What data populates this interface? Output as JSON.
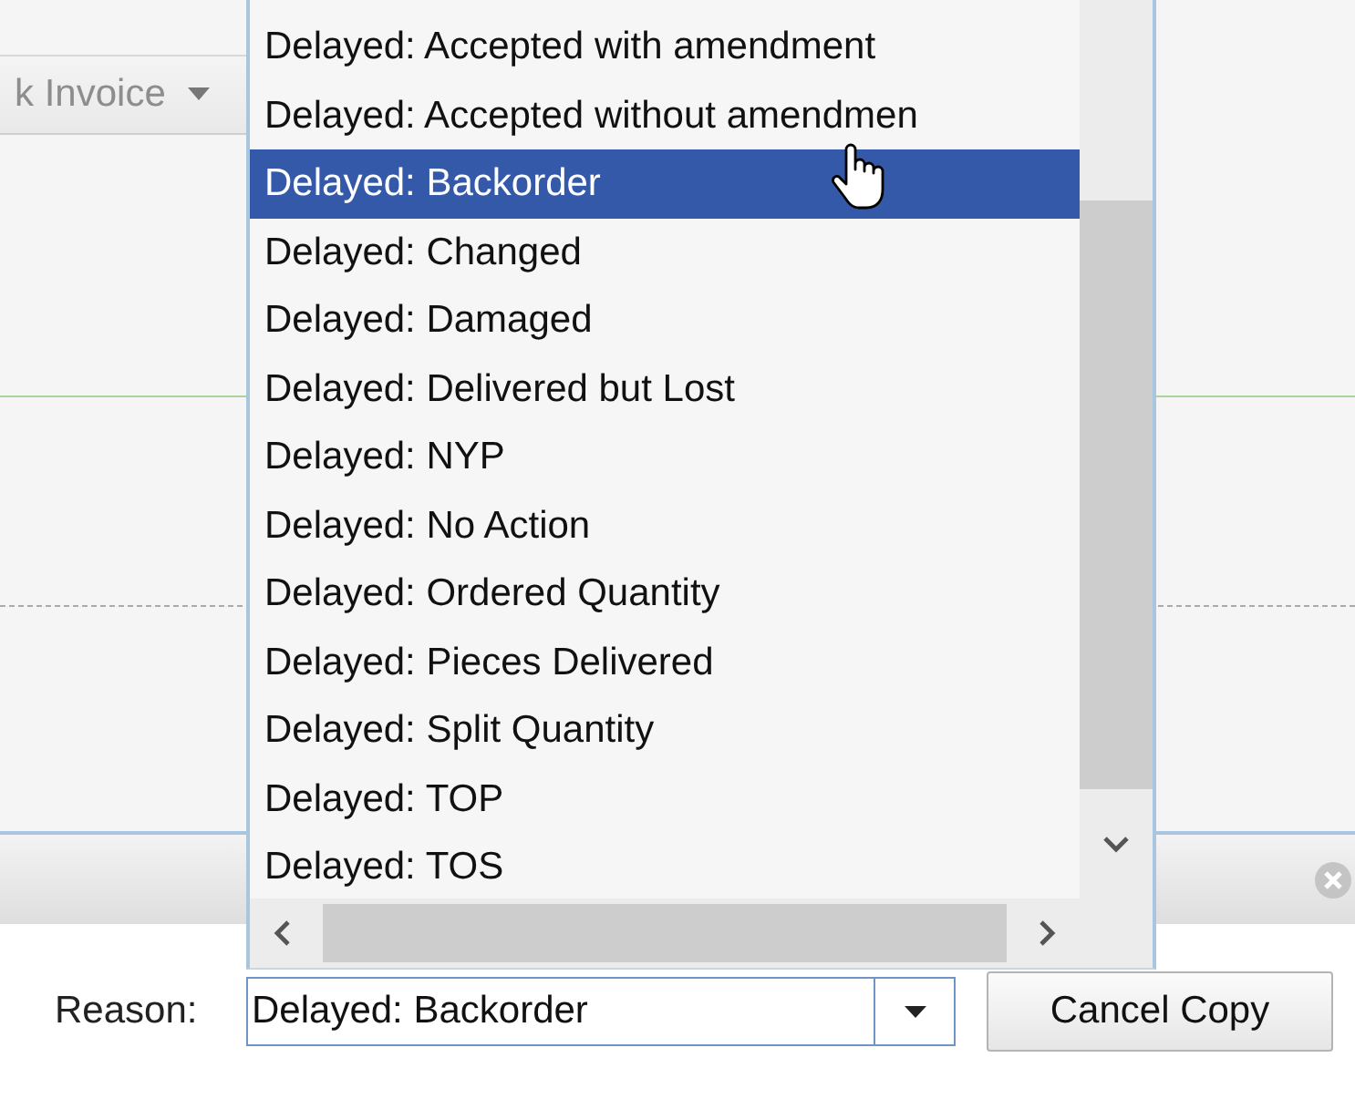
{
  "background": {
    "toolbar_dropdown": {
      "value": "k Invoice"
    }
  },
  "dropdown_list": {
    "items": [
      {
        "label": "Delayed: Accepted with amendment",
        "selected": false
      },
      {
        "label": "Delayed: Accepted without amendmen",
        "selected": false
      },
      {
        "label": "Delayed: Backorder",
        "selected": true
      },
      {
        "label": "Delayed: Changed",
        "selected": false
      },
      {
        "label": "Delayed: Damaged",
        "selected": false
      },
      {
        "label": "Delayed: Delivered but Lost",
        "selected": false
      },
      {
        "label": "Delayed: NYP",
        "selected": false
      },
      {
        "label": "Delayed: No Action",
        "selected": false
      },
      {
        "label": "Delayed: Ordered Quantity",
        "selected": false
      },
      {
        "label": "Delayed: Pieces Delivered",
        "selected": false
      },
      {
        "label": "Delayed: Split Quantity",
        "selected": false
      },
      {
        "label": "Delayed: TOP",
        "selected": false
      },
      {
        "label": "Delayed: TOS",
        "selected": false
      }
    ]
  },
  "reason_row": {
    "label": "Reason:",
    "combo": {
      "value": "Delayed: Backorder"
    },
    "buttons": [
      {
        "label": "Cancel Copy"
      }
    ]
  }
}
